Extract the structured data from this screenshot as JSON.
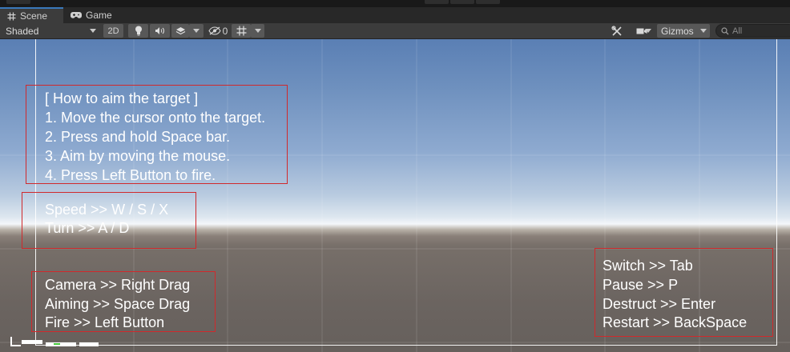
{
  "tabs": {
    "scene": "Scene",
    "game": "Game"
  },
  "toolbar": {
    "shading_mode": "Shaded",
    "mode_2d": "2D",
    "hidden_count": "0",
    "gizmos": "Gizmos",
    "search_placeholder": "All"
  },
  "instructions": {
    "aim_lines": [
      "[ How to aim the target ]",
      "1. Move the cursor onto the target.",
      "2. Press and hold Space bar.",
      "3. Aim by moving the mouse.",
      "4. Press Left Button to fire."
    ],
    "drive_lines": [
      "Speed >> W / S / X",
      "Turn >> A / D"
    ],
    "mouse_lines": [
      "Camera >> Right Drag",
      "Aiming >> Space Drag",
      "Fire >> Left Button"
    ],
    "system_lines": [
      "Switch >> Tab",
      "Pause >> P",
      "Destruct >> Enter",
      "Restart >> BackSpace"
    ]
  },
  "colors": {
    "box_outline": "#d0292c",
    "active_tab_accent": "#3a79bb",
    "stats_accent": "#45c83a"
  },
  "icons": {
    "scene_tab": "grid-hash-icon",
    "game_tab": "gamepad-icon",
    "lighting": "lightbulb-icon",
    "audio": "speaker-icon",
    "effects": "layers-icon",
    "visibility": "eye-slash-icon",
    "grid": "grid-icon",
    "tools": "tools-icon",
    "camera": "camera-icon",
    "search": "search-icon"
  }
}
